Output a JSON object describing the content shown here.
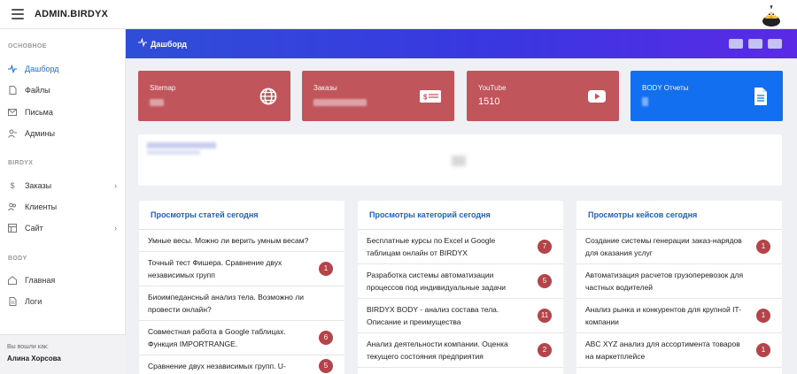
{
  "app": {
    "brand": "ADMIN.BIRDYX"
  },
  "sidebar": {
    "sections": [
      {
        "title": "ОСНОВНОЕ"
      },
      {
        "title": "BIRDYX"
      },
      {
        "title": "BODY"
      }
    ],
    "items": [
      {
        "label": "Дашборд",
        "icon": "activity-icon",
        "active": true
      },
      {
        "label": "Файлы",
        "icon": "file-icon"
      },
      {
        "label": "Письма",
        "icon": "mail-icon"
      },
      {
        "label": "Админы",
        "icon": "user-icon"
      },
      {
        "label": "Заказы",
        "icon": "dollar-icon",
        "has_children": true
      },
      {
        "label": "Клиенты",
        "icon": "users-icon"
      },
      {
        "label": "Сайт",
        "icon": "layout-icon",
        "has_children": true
      },
      {
        "label": "Главная",
        "icon": "home-icon"
      },
      {
        "label": "Логи",
        "icon": "document-icon"
      }
    ],
    "user": {
      "label": "Вы вошли как:",
      "name": "Алина Хорсова"
    }
  },
  "header": {
    "title": "Дашборд"
  },
  "cards": [
    {
      "label": "Sitemap",
      "value": "",
      "color": "#c0565c",
      "icon": "globe-icon"
    },
    {
      "label": "Заказы",
      "value": "",
      "color": "#c0565c",
      "icon": "money-icon"
    },
    {
      "label": "YouTube",
      "value": "1510",
      "color": "#c0565c",
      "icon": "youtube-icon"
    },
    {
      "label": "BODY Отчеты",
      "value": "",
      "color": "#1270f0",
      "icon": "report-icon"
    }
  ],
  "panels": [
    {
      "title": "Просмотры статей сегодня",
      "rows": [
        {
          "text": "Умные весы. Можно ли верить умным весам?",
          "count": ""
        },
        {
          "text": "Точный тест Фишера. Сравнение двух независимых групп",
          "count": "1"
        },
        {
          "text": "Биоимпедансный анализ тела. Возможно ли провести онлайн?",
          "count": ""
        },
        {
          "text": "Совместная работа в Google таблицах. Функция IMPORTRANGE.",
          "count": "6"
        },
        {
          "text": "Сравнение двух независимых групп. U-",
          "count": "5"
        }
      ]
    },
    {
      "title": "Просмотры категорий сегодня",
      "rows": [
        {
          "text": "Бесплатные курсы по Excel и Google таблицам онлайн от BIRDYX",
          "count": "7"
        },
        {
          "text": "Разработка системы автоматизации процессов под индивидуальные задачи",
          "count": "5"
        },
        {
          "text": "BIRDYX BODY - анализ состава тела. Описание и преимущества",
          "count": "11"
        },
        {
          "text": "Анализ деятельности компании. Оценка текущего состояния предприятия",
          "count": "2"
        }
      ]
    },
    {
      "title": "Просмотры кейсов сегодня",
      "rows": [
        {
          "text": "Создание системы генерации заказ-нарядов для оказания услуг",
          "count": "1"
        },
        {
          "text": "Автоматизация расчетов грузоперевозок для частных водителей",
          "count": ""
        },
        {
          "text": "Анализ рынка и конкурентов для крупной IT-компании",
          "count": "1"
        },
        {
          "text": "ABC XYZ анализ для ассортимента товаров на маркетплейсе",
          "count": "1"
        }
      ]
    }
  ]
}
